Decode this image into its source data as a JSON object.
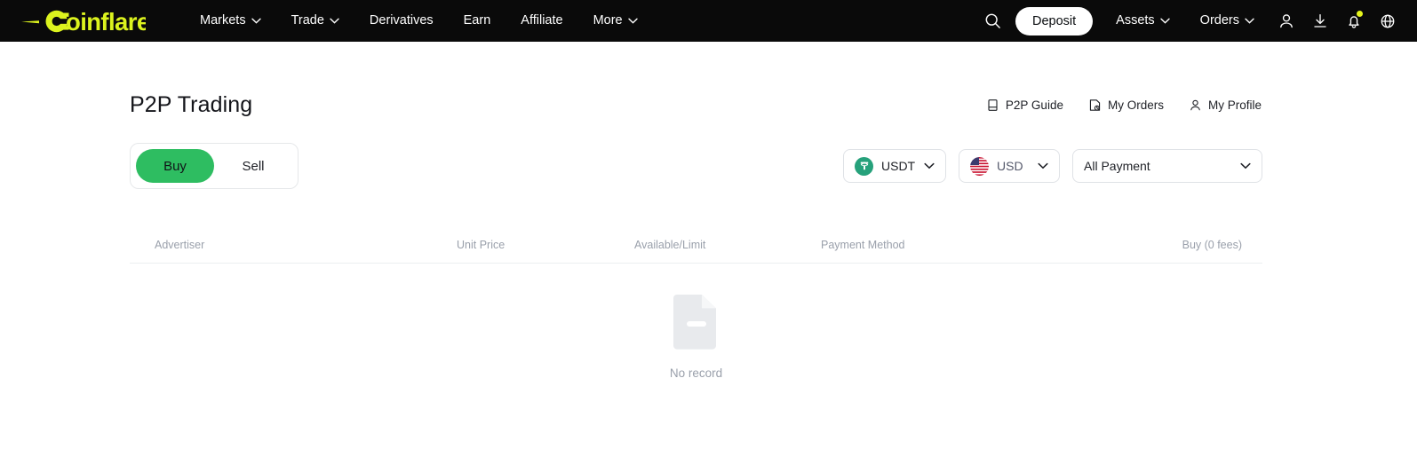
{
  "brand": {
    "name": "Coinflare",
    "color": "#dcf31e"
  },
  "topnav": {
    "items": [
      {
        "label": "Markets",
        "has_caret": true
      },
      {
        "label": "Trade",
        "has_caret": true
      },
      {
        "label": "Derivatives",
        "has_caret": false
      },
      {
        "label": "Earn",
        "has_caret": false
      },
      {
        "label": "Affiliate",
        "has_caret": false
      },
      {
        "label": "More",
        "has_caret": true
      }
    ],
    "search_icon": "search-icon",
    "deposit_label": "Deposit",
    "assets_label": "Assets",
    "orders_label": "Orders",
    "icons": [
      "user-icon",
      "download-icon",
      "bell-icon",
      "globe-icon"
    ],
    "notification_dot_color": "#e6f51c"
  },
  "page": {
    "title": "P2P Trading",
    "links": [
      {
        "label": "P2P Guide",
        "icon": "book-icon"
      },
      {
        "label": "My Orders",
        "icon": "order-history-icon"
      },
      {
        "label": "My Profile",
        "icon": "user-icon"
      }
    ]
  },
  "side_toggle": {
    "buy_label": "Buy",
    "sell_label": "Sell",
    "active": "Buy",
    "active_color": "#2ebd61"
  },
  "filters": {
    "asset": {
      "value": "USDT",
      "icon": "tether-icon",
      "icon_color": "#26a17b"
    },
    "fiat": {
      "value": "USD",
      "icon": "us-flag-icon"
    },
    "payment": {
      "value": "All Payment"
    }
  },
  "table": {
    "columns": [
      "Advertiser",
      "Unit Price",
      "Available/Limit",
      "Payment Method",
      "Buy (0 fees)"
    ],
    "rows": [],
    "empty_text": "No record",
    "empty_icon": "empty-document-icon"
  }
}
